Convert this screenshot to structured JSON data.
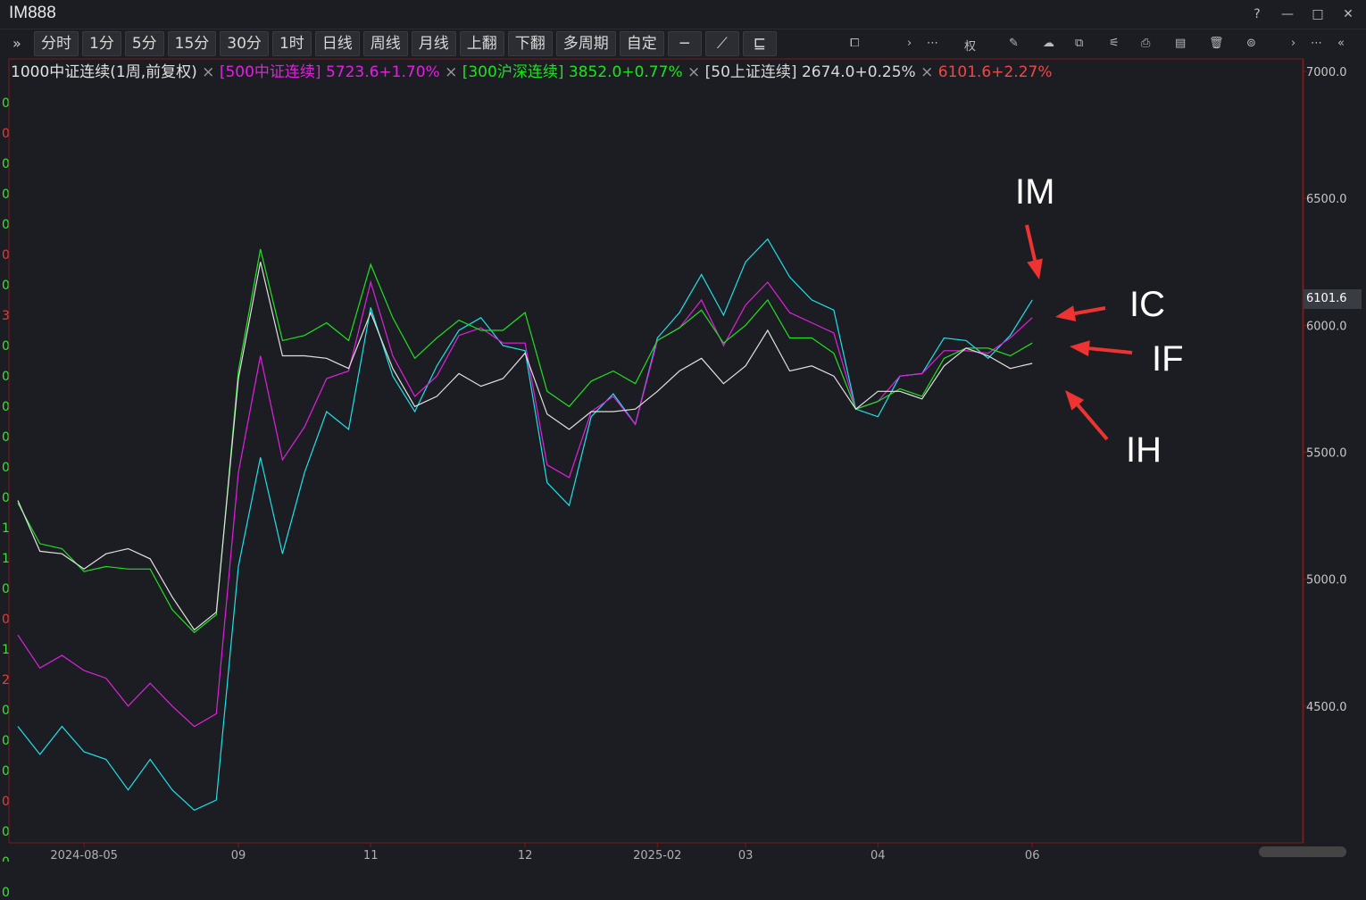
{
  "window": {
    "title": "IM888",
    "buttons": [
      "?",
      "—",
      "□",
      "✕"
    ]
  },
  "toolbar": {
    "expand": "»",
    "periods": [
      "分时",
      "1分",
      "5分",
      "15分",
      "30分",
      "1时",
      "日线",
      "周线",
      "月线",
      "上翻",
      "下翻",
      "多周期",
      "自定"
    ],
    "tools": [
      "─",
      "⟋",
      "⊑",
      "⧠",
      "›",
      "⋯",
      "权",
      "✎",
      "☁",
      "⧉",
      "⚟",
      "⎙",
      "▤",
      "🗑",
      "⊚",
      "›",
      "⋯",
      "«"
    ]
  },
  "legend": {
    "main": "1000中证连续(1周,前复权)",
    "items": [
      {
        "label": "[500中证连续]",
        "value": "5723.6+1.70%",
        "color": "#e020e0"
      },
      {
        "label": "[300沪深连续]",
        "value": "3852.0+0.77%",
        "color": "#20e020"
      },
      {
        "label": "[50上证连续]",
        "value": "2674.0+0.25%",
        "color": "#d8d8d8"
      }
    ],
    "main_value": "6101.6+2.27%",
    "main_color": "#f04848",
    "separator": "×"
  },
  "annotations": {
    "IM": "IM",
    "IC": "IC",
    "IF": "IF",
    "IH": "IH"
  },
  "current_price": "6101.6",
  "chart_data": {
    "type": "line",
    "x": [
      "2024-07-12",
      "2024-07-19",
      "2024-07-26",
      "2024-08-02",
      "2024-08-09",
      "2024-08-16",
      "2024-08-23",
      "2024-08-30",
      "2024-09-06",
      "2024-09-13",
      "2024-09-20",
      "2024-09-27",
      "2024-10-11",
      "2024-10-18",
      "2024-10-25",
      "2024-11-01",
      "2024-11-08",
      "2024-11-15",
      "2024-11-22",
      "2024-11-29",
      "2024-12-06",
      "2024-12-13",
      "2024-12-20",
      "2024-12-27",
      "2025-01-03",
      "2025-01-10",
      "2025-01-17",
      "2025-01-24",
      "2025-02-07",
      "2025-02-14",
      "2025-02-21",
      "2025-02-28",
      "2025-03-07",
      "2025-03-14",
      "2025-03-21",
      "2025-03-28",
      "2025-04-03",
      "2025-04-11",
      "2025-04-18",
      "2025-04-25",
      "2025-04-30",
      "2025-05-09",
      "2025-05-16",
      "2025-05-23",
      "2025-05-30",
      "2025-06-06"
    ],
    "x_ticks": [
      "2024-08-05",
      "09",
      "11",
      "12",
      "2025-02",
      "03",
      "04",
      "06"
    ],
    "ylim": [
      4000,
      7000
    ],
    "y_ticks": [
      "7000.0",
      "6500.0",
      "6000.0",
      "5500.0",
      "5000.0",
      "4500.0"
    ],
    "series": [
      {
        "name": "1000中证连续",
        "color": "#20e0e8",
        "values": [
          4420,
          4310,
          4420,
          4320,
          4290,
          4170,
          4290,
          4170,
          4090,
          4130,
          5050,
          5480,
          5100,
          5420,
          5660,
          5590,
          6070,
          5800,
          5660,
          5840,
          5980,
          6030,
          5920,
          5900,
          5380,
          5290,
          5640,
          5730,
          5610,
          5950,
          6050,
          6200,
          6040,
          6250,
          6340,
          6190,
          6100,
          6060,
          5670,
          5640,
          5800,
          5810,
          5950,
          5940,
          5870,
          5960,
          6100
        ]
      },
      {
        "name": "500中证连续",
        "color": "#e020e0",
        "values": [
          4780,
          4650,
          4700,
          4640,
          4610,
          4500,
          4590,
          4500,
          4420,
          4470,
          5420,
          5880,
          5470,
          5600,
          5790,
          5820,
          6170,
          5880,
          5720,
          5800,
          5960,
          5990,
          5930,
          5930,
          5450,
          5400,
          5660,
          5720,
          5610,
          5940,
          5990,
          6100,
          5920,
          6080,
          6170,
          6050,
          6010,
          5970,
          5670,
          5700,
          5800,
          5810,
          5900,
          5900,
          5890,
          5950,
          6030
        ]
      },
      {
        "name": "300沪深连续",
        "color": "#20e020",
        "values": [
          5300,
          5140,
          5120,
          5030,
          5050,
          5040,
          5040,
          4880,
          4790,
          4860,
          5820,
          6300,
          5940,
          5960,
          6010,
          5940,
          6240,
          6030,
          5870,
          5950,
          6020,
          5980,
          5980,
          6050,
          5740,
          5680,
          5780,
          5820,
          5770,
          5940,
          5990,
          6060,
          5930,
          6000,
          6100,
          5950,
          5950,
          5890,
          5670,
          5700,
          5750,
          5720,
          5870,
          5910,
          5910,
          5880,
          5930
        ]
      },
      {
        "name": "50上证连续",
        "color": "#e0e0e0",
        "values": [
          5310,
          5110,
          5100,
          5040,
          5100,
          5120,
          5080,
          4930,
          4800,
          4870,
          5790,
          6250,
          5880,
          5880,
          5870,
          5830,
          6050,
          5830,
          5680,
          5720,
          5810,
          5760,
          5790,
          5890,
          5650,
          5590,
          5660,
          5660,
          5670,
          5740,
          5820,
          5870,
          5770,
          5840,
          5980,
          5820,
          5840,
          5800,
          5670,
          5740,
          5740,
          5710,
          5840,
          5910,
          5880,
          5830,
          5850
        ]
      }
    ]
  },
  "left_strip": [
    "0",
    "0",
    "0",
    "0",
    "0",
    "0",
    "0",
    "3",
    "0",
    "0",
    "0",
    "0",
    "0",
    "0",
    "1",
    "1",
    "0",
    "0",
    "1",
    "2",
    "0",
    "0",
    "0",
    "0",
    "0",
    "0",
    "0"
  ],
  "left_strip_colors": [
    "#40e040",
    "#e04040",
    "#40e040",
    "#40e040",
    "#40e040",
    "#e04040",
    "#40e040",
    "#e04040",
    "#40e040",
    "#40e040",
    "#40e040",
    "#40e040",
    "#40e040",
    "#40e040",
    "#40e040",
    "#40e040",
    "#40e040",
    "#e04040",
    "#40e040",
    "#e04040",
    "#40e040",
    "#40e040",
    "#40e040",
    "#e04040",
    "#40e040",
    "#40e040",
    "#40e040"
  ]
}
